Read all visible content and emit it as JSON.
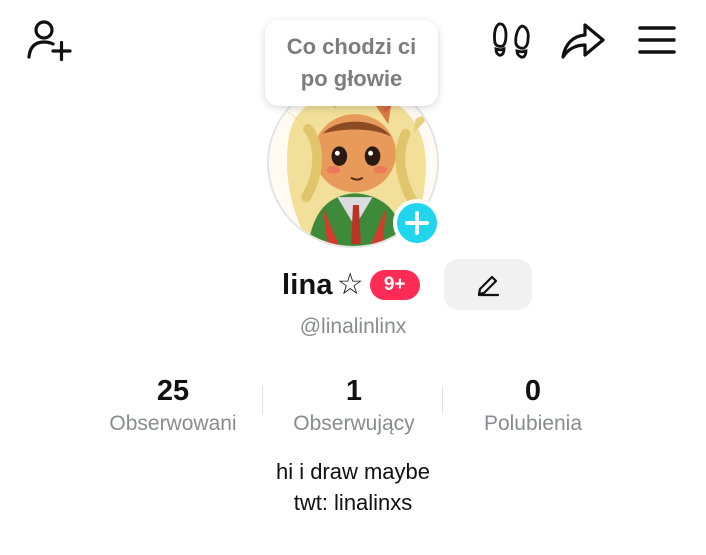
{
  "thought_bubble": "Co chodzi ci po głowie",
  "profile": {
    "name": "lina",
    "star": "☆",
    "badge": "9+",
    "handle": "@linalinlinx"
  },
  "stats": [
    {
      "value": "25",
      "label": "Obserwowani"
    },
    {
      "value": "1",
      "label": "Obserwujący"
    },
    {
      "value": "0",
      "label": "Polubienia"
    }
  ],
  "bio": {
    "line1": "hi i draw maybe",
    "line2": "twt: linalinxs"
  },
  "icons": {
    "add_friend": "add-friend-icon",
    "footprints": "footprints-icon",
    "share": "share-icon",
    "menu": "menu-icon",
    "edit": "pencil-icon",
    "add_avatar": "plus-icon"
  },
  "colors": {
    "badge": "#fe2c55",
    "add_avatar": "#20d5ec",
    "secondary_text": "#8a8b91"
  }
}
